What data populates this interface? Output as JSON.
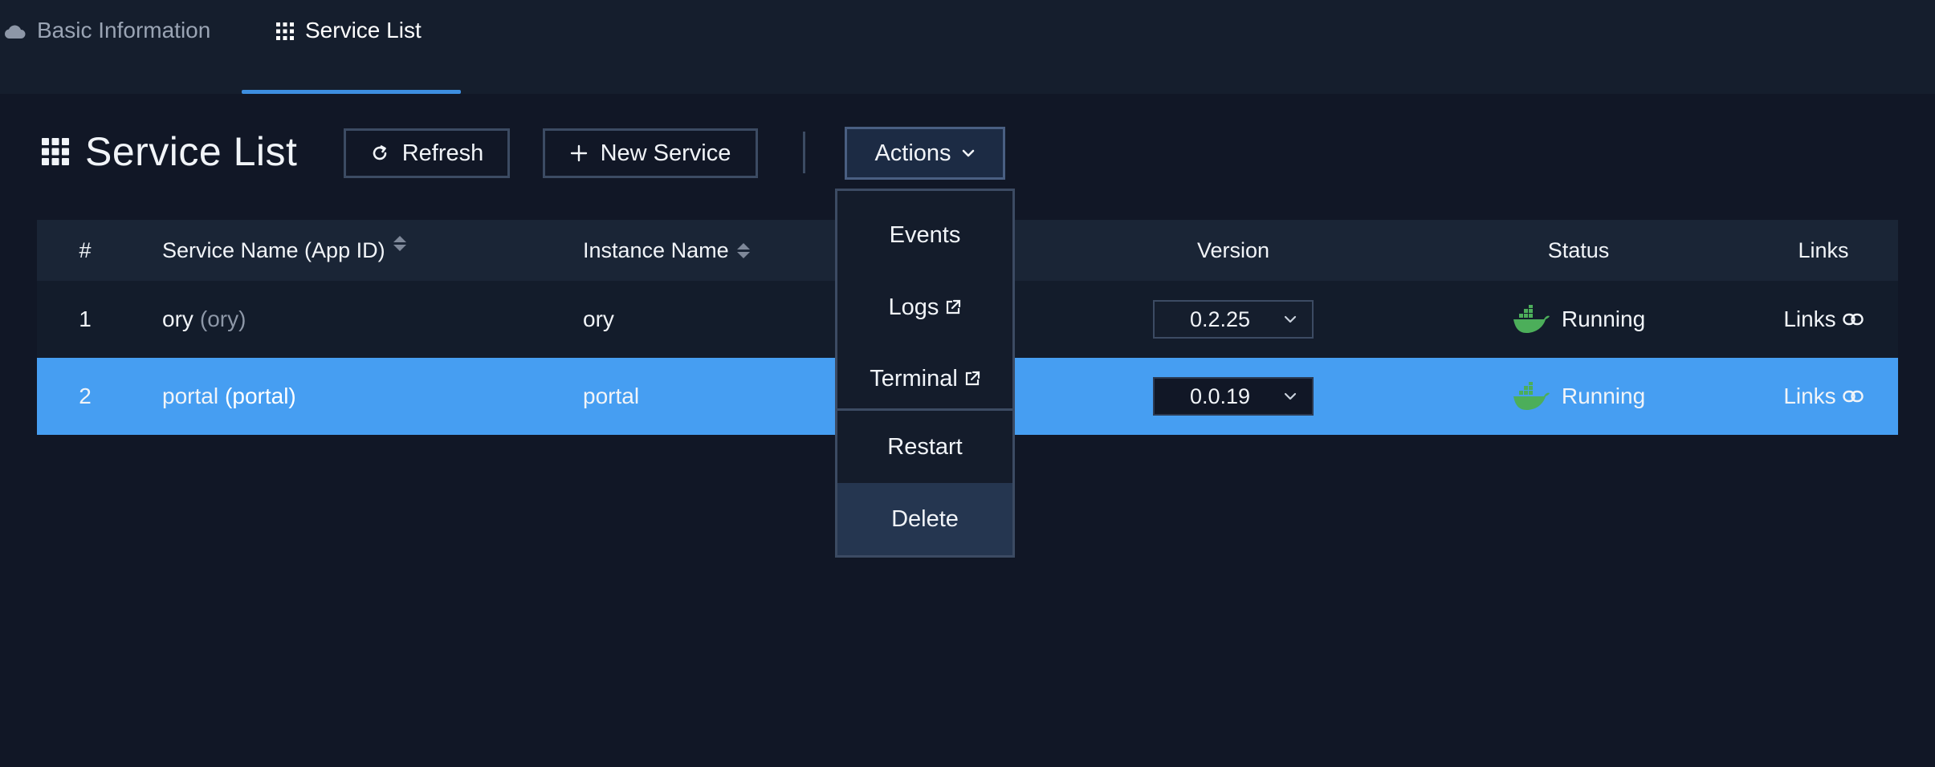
{
  "tabs": [
    {
      "label": "Basic Information",
      "icon": "cloud-icon",
      "active": false
    },
    {
      "label": "Service List",
      "icon": "grid-icon",
      "active": true
    }
  ],
  "header": {
    "title": "Service List",
    "title_icon": "grid-icon"
  },
  "toolbar": {
    "refresh_label": "Refresh",
    "new_service_label": "New Service",
    "actions_label": "Actions"
  },
  "actions_menu": {
    "items": [
      {
        "label": "Events"
      },
      {
        "label": "Logs",
        "icon": "external-link-icon"
      },
      {
        "label": "Terminal",
        "icon": "external-link-icon"
      },
      {
        "label": "Restart"
      },
      {
        "label": "Delete",
        "highlighted": true
      }
    ]
  },
  "table": {
    "columns": [
      "#",
      "Service Name (App ID)",
      "Instance Name",
      "Version",
      "Status",
      "Links"
    ],
    "rows": [
      {
        "num": "1",
        "name": "ory",
        "app_id": "(ory)",
        "instance": "ory",
        "version": "0.2.25",
        "status": "Running",
        "links": "Links",
        "selected": false
      },
      {
        "num": "2",
        "name": "portal",
        "app_id": "(portal)",
        "instance": "portal",
        "version": "0.0.19",
        "status": "Running",
        "links": "Links",
        "selected": true
      }
    ]
  },
  "colors": {
    "background": "#111726",
    "accent": "#3d8ee0",
    "selected_row": "#469ef2",
    "status_docker": "#4cae5a"
  }
}
